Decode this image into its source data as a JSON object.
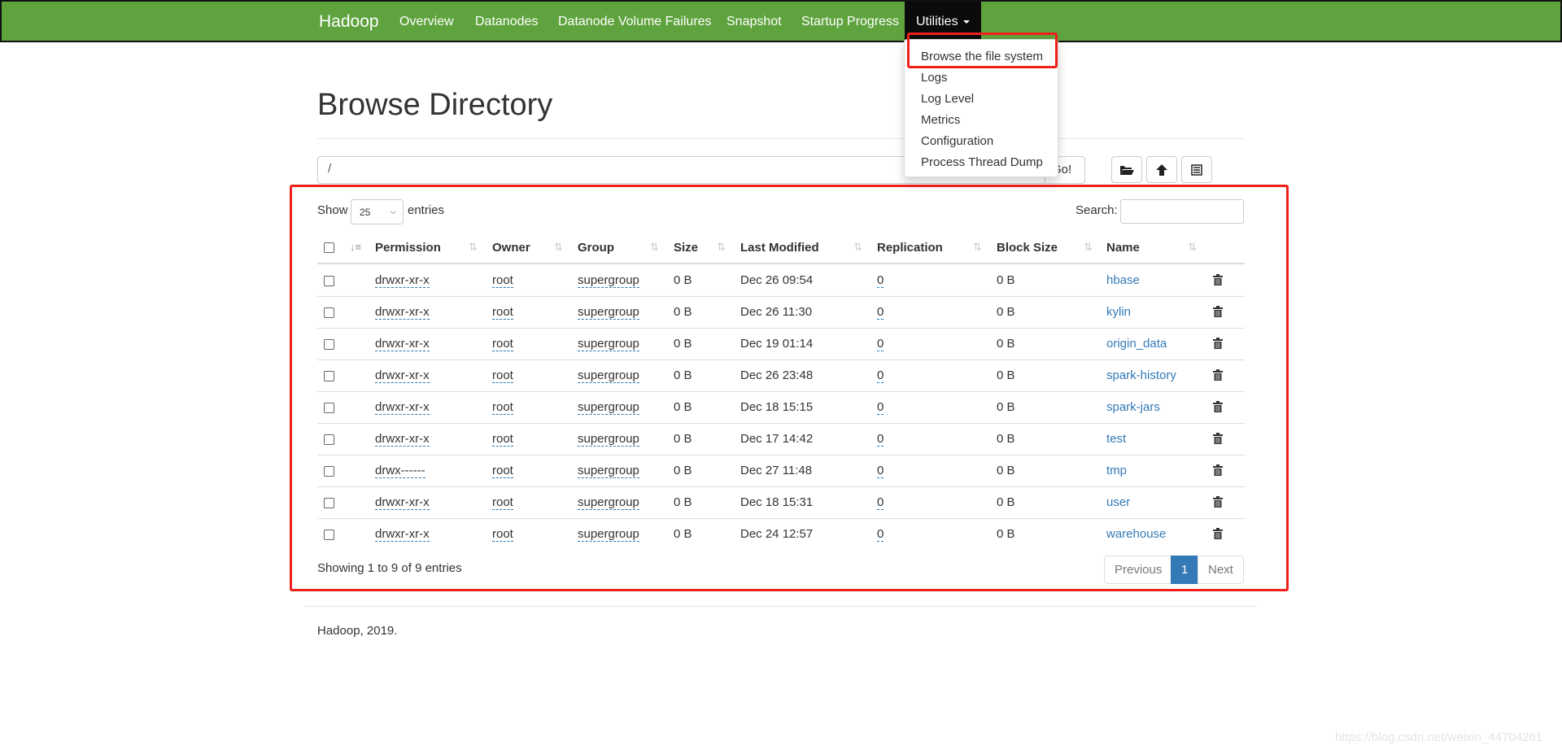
{
  "navbar": {
    "brand": "Hadoop",
    "items": [
      "Overview",
      "Datanodes",
      "Datanode Volume Failures",
      "Snapshot",
      "Startup Progress"
    ],
    "utilities": "Utilities",
    "dropdown": [
      "Browse the file system",
      "Logs",
      "Log Level",
      "Metrics",
      "Configuration",
      "Process Thread Dump"
    ]
  },
  "page": {
    "title": "Browse Directory",
    "path_value": "/",
    "go_label": "Go!",
    "icons": [
      "folder-open-icon",
      "cloud-upload-icon",
      "list-alt-icon"
    ]
  },
  "table_controls": {
    "show": "Show",
    "entries": "entries",
    "page_length": "25",
    "search_label": "Search:",
    "search_value": ""
  },
  "table": {
    "columns": [
      "Permission",
      "Owner",
      "Group",
      "Size",
      "Last Modified",
      "Replication",
      "Block Size",
      "Name"
    ],
    "rows": [
      {
        "permission": "drwxr-xr-x",
        "owner": "root",
        "group": "supergroup",
        "size": "0 B",
        "modified": "Dec 26 09:54",
        "replication": "0",
        "block_size": "0 B",
        "name": "hbase"
      },
      {
        "permission": "drwxr-xr-x",
        "owner": "root",
        "group": "supergroup",
        "size": "0 B",
        "modified": "Dec 26 11:30",
        "replication": "0",
        "block_size": "0 B",
        "name": "kylin"
      },
      {
        "permission": "drwxr-xr-x",
        "owner": "root",
        "group": "supergroup",
        "size": "0 B",
        "modified": "Dec 19 01:14",
        "replication": "0",
        "block_size": "0 B",
        "name": "origin_data"
      },
      {
        "permission": "drwxr-xr-x",
        "owner": "root",
        "group": "supergroup",
        "size": "0 B",
        "modified": "Dec 26 23:48",
        "replication": "0",
        "block_size": "0 B",
        "name": "spark-history"
      },
      {
        "permission": "drwxr-xr-x",
        "owner": "root",
        "group": "supergroup",
        "size": "0 B",
        "modified": "Dec 18 15:15",
        "replication": "0",
        "block_size": "0 B",
        "name": "spark-jars"
      },
      {
        "permission": "drwxr-xr-x",
        "owner": "root",
        "group": "supergroup",
        "size": "0 B",
        "modified": "Dec 17 14:42",
        "replication": "0",
        "block_size": "0 B",
        "name": "test"
      },
      {
        "permission": "drwx------",
        "owner": "root",
        "group": "supergroup",
        "size": "0 B",
        "modified": "Dec 27 11:48",
        "replication": "0",
        "block_size": "0 B",
        "name": "tmp"
      },
      {
        "permission": "drwxr-xr-x",
        "owner": "root",
        "group": "supergroup",
        "size": "0 B",
        "modified": "Dec 18 15:31",
        "replication": "0",
        "block_size": "0 B",
        "name": "user"
      },
      {
        "permission": "drwxr-xr-x",
        "owner": "root",
        "group": "supergroup",
        "size": "0 B",
        "modified": "Dec 24 12:57",
        "replication": "0",
        "block_size": "0 B",
        "name": "warehouse"
      }
    ]
  },
  "pagination": {
    "info": "Showing 1 to 9 of 9 entries",
    "previous": "Previous",
    "current": "1",
    "next": "Next"
  },
  "footer": "Hadoop, 2019.",
  "watermark": "https://blog.csdn.net/weixin_44704261",
  "colors": {
    "navbar": "#5fa33e",
    "link": "#337ab7",
    "highlight": "#f0201a"
  }
}
